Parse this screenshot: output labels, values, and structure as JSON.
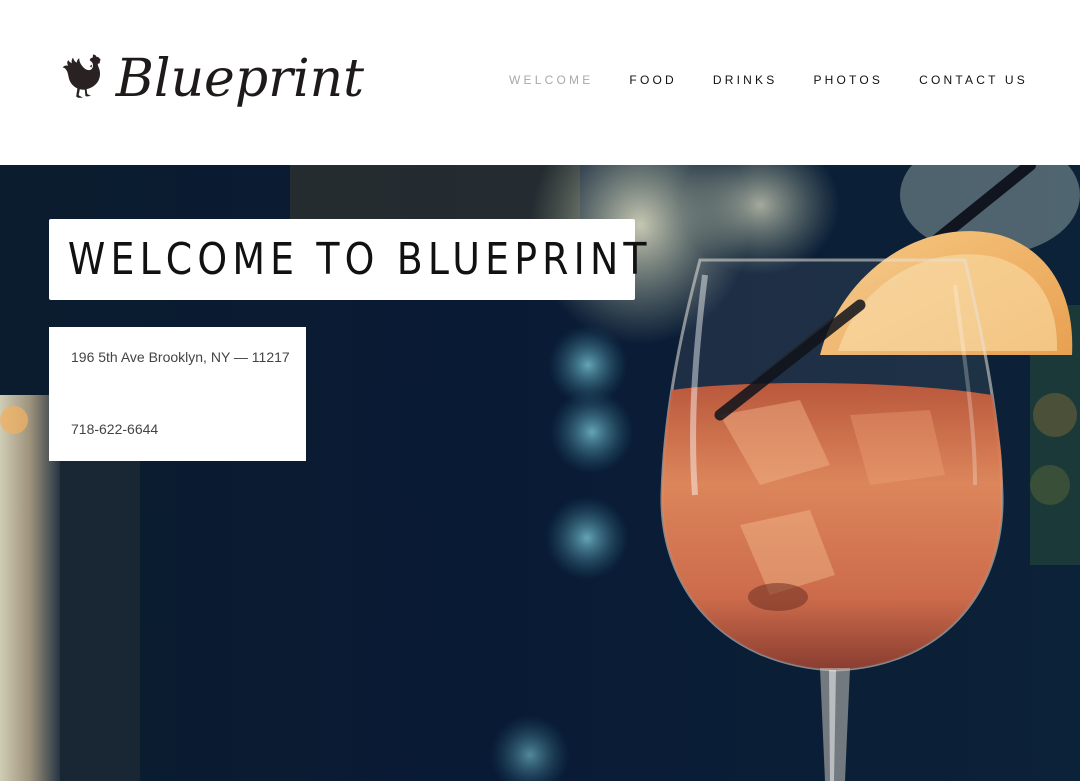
{
  "brand": {
    "name": "Blueprint",
    "logo_icon": "rooster-icon"
  },
  "nav": {
    "items": [
      {
        "label": "WELCOME",
        "active": true
      },
      {
        "label": "FOOD",
        "active": false
      },
      {
        "label": "DRINKS",
        "active": false
      },
      {
        "label": "PHOTOS",
        "active": false
      },
      {
        "label": "CONTACT US",
        "active": false
      }
    ]
  },
  "hero": {
    "title": "WELCOME TO BLUEPRINT",
    "address": "196 5th Ave Brooklyn, NY — 11217",
    "phone": "718-622-6644",
    "image": "cocktail-photo"
  },
  "colors": {
    "text_dark": "#111111",
    "nav_active": "#a9a9a9",
    "hero_background": "#0a1a33",
    "drink": "#d9734a"
  }
}
